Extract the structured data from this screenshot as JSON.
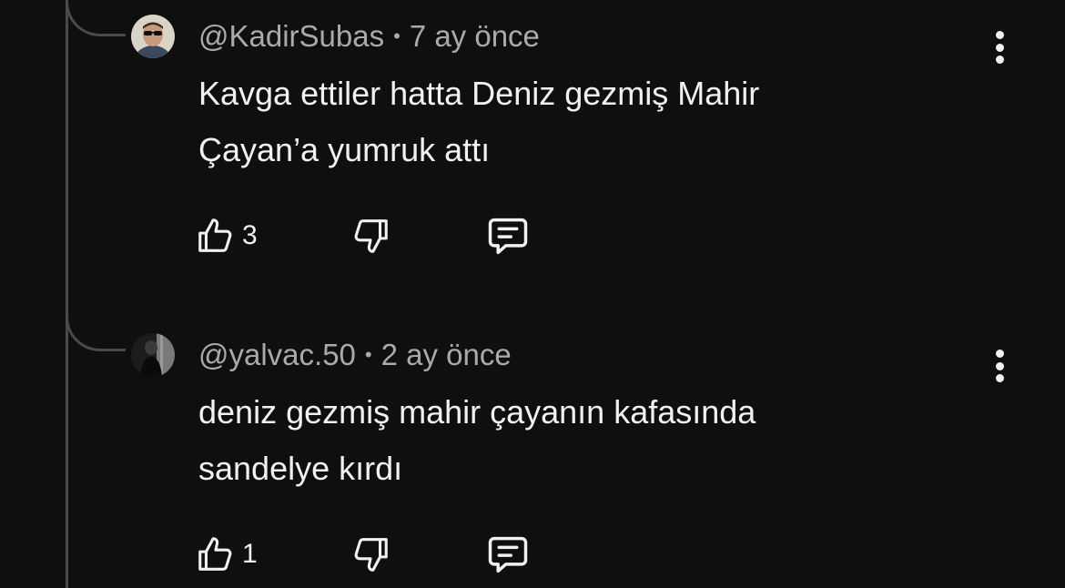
{
  "comments": [
    {
      "username": "@KadirSubas",
      "separator": "•",
      "time": "7 ay önce",
      "text_line1": "Kavga ettiler hatta Deniz gezmiş Mahir",
      "text_line2": "Çayan’a yumruk attı",
      "likes": "3",
      "avatar": "avatar-sunglasses-man",
      "like_icon": "thumbs-up-icon",
      "dislike_icon": "thumbs-down-icon",
      "reply_icon": "reply-comment-icon",
      "menu_icon": "more-vertical-icon"
    },
    {
      "username": "@yalvac.50",
      "separator": "•",
      "time": "2 ay önce",
      "text_line1": "deniz gezmiş mahir çayanın kafasında",
      "text_line2": "sandelye kırdı",
      "likes": "1",
      "avatar": "avatar-dark-silhouette",
      "like_icon": "thumbs-up-icon",
      "dislike_icon": "thumbs-down-icon",
      "reply_icon": "reply-comment-icon",
      "menu_icon": "more-vertical-icon"
    }
  ],
  "colors": {
    "background": "#0f0f0f",
    "text_primary": "#f1f1f1",
    "text_secondary": "#aaaaaa",
    "thread_line": "#4a4a4a"
  }
}
